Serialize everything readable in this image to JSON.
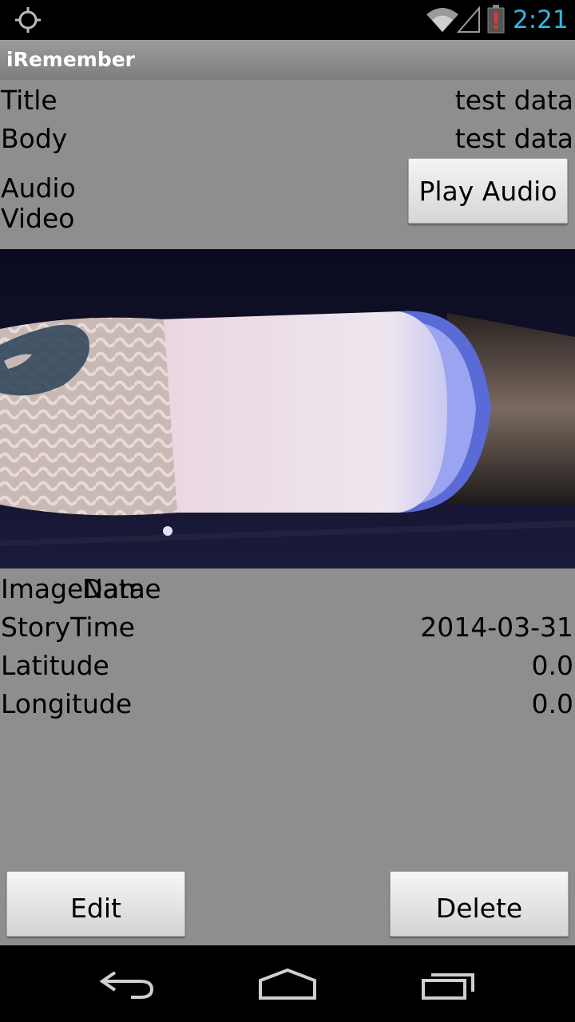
{
  "status_bar": {
    "time": "2:21",
    "icons": [
      "gps-icon",
      "wifi-icon",
      "signal-icon",
      "battery-alert-icon"
    ],
    "time_color": "#33b5e5"
  },
  "app": {
    "title": "iRemember"
  },
  "fields": {
    "title_label": "Title",
    "title_value": "test data",
    "body_label": "Body",
    "body_value": "test data",
    "audio_label": "Audio",
    "video_label": "Video",
    "image_name_label": "ImageName",
    "image_name_overlap": "Data",
    "story_time_label": "StoryTime",
    "story_time_value": "2014-03-31",
    "latitude_label": "Latitude",
    "latitude_value": "0.0",
    "longitude_label": "Longitude",
    "longitude_value": "0.0"
  },
  "buttons": {
    "play_audio": "Play Audio",
    "edit": "Edit",
    "delete": "Delete"
  },
  "nav_bar": {
    "icons": [
      "back-icon",
      "home-icon",
      "recent-apps-icon"
    ]
  }
}
